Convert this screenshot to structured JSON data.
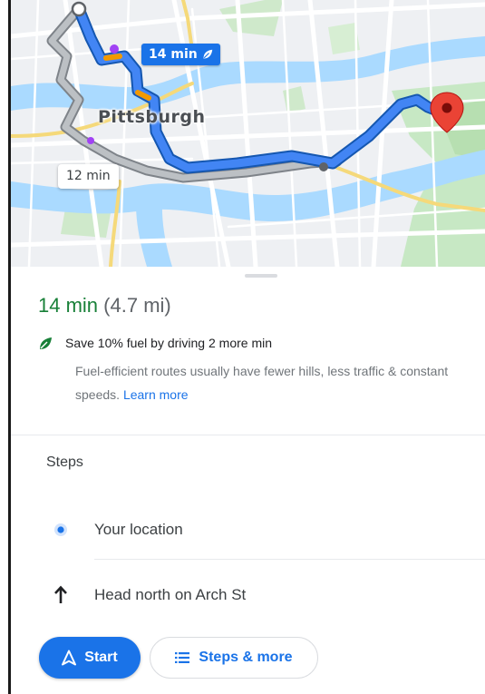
{
  "map": {
    "city_label": "Pittsburgh",
    "primary_route_time": "14 min",
    "alternate_route_time": "12 min",
    "primary_route_icon": "leaf-icon",
    "destination_icon": "map-pin-icon",
    "colors": {
      "route": "#1a73e8",
      "alt_route": "#a7abb1",
      "water": "#aadaff",
      "park": "#c7e8c4",
      "destination_pin": "#ea4335"
    }
  },
  "summary": {
    "duration": "14 min",
    "distance": "(4.7 mi)",
    "color": "#188038"
  },
  "eco": {
    "icon": "leaf-icon",
    "title": "Save 10% fuel by driving 2 more min",
    "description": "Fuel-efficient routes usually have fewer hills, less traffic & constant speeds.",
    "learn_more": "Learn more"
  },
  "steps": {
    "header": "Steps",
    "items": [
      {
        "icon": "location-dot-icon",
        "label": "Your location"
      },
      {
        "icon": "arrow-up-icon",
        "label": "Head north on Arch St"
      }
    ]
  },
  "actions": {
    "start_label": "Start",
    "start_icon": "navigation-arrow-icon",
    "steps_label": "Steps & more",
    "steps_icon": "list-icon"
  }
}
